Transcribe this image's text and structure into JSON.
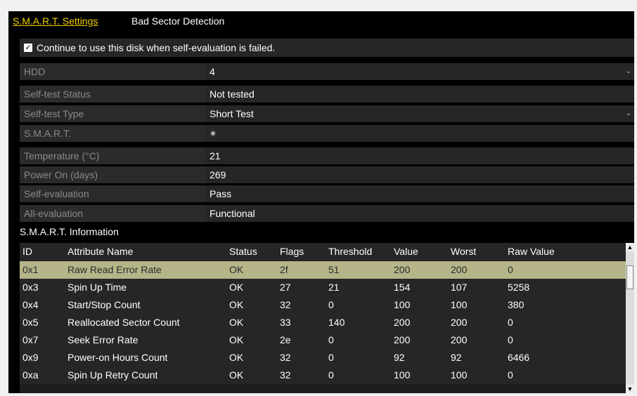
{
  "tabs": [
    {
      "label": "S.M.A.R.T. Settings",
      "active": true
    },
    {
      "label": "Bad Sector Detection",
      "active": false
    }
  ],
  "continue_option": {
    "label": "Continue to use this disk when self-evaluation is failed.",
    "checked": true
  },
  "fields": {
    "hdd": {
      "label": "HDD",
      "value": "4"
    },
    "self_test_status": {
      "label": "Self-test Status",
      "value": "Not tested"
    },
    "self_test_type": {
      "label": "Self-test Type",
      "value": "Short Test"
    },
    "smart": {
      "label": "S.M.A.R.T.",
      "icon": "gear-icon"
    },
    "temperature": {
      "label": "Temperature (°C)",
      "value": "21"
    },
    "power_on": {
      "label": "Power On (days)",
      "value": "269"
    },
    "self_evaluation": {
      "label": "Self-evaluation",
      "value": "Pass"
    },
    "all_evaluation": {
      "label": "All-evaluation",
      "value": "Functional"
    }
  },
  "info_title": "S.M.A.R.T. Information",
  "table": {
    "columns": [
      "ID",
      "Attribute Name",
      "Status",
      "Flags",
      "Threshold",
      "Value",
      "Worst",
      "Raw Value"
    ],
    "rows": [
      [
        "0x1",
        "Raw Read Error Rate",
        "OK",
        "2f",
        "51",
        "200",
        "200",
        "0"
      ],
      [
        "0x3",
        "Spin Up Time",
        "OK",
        "27",
        "21",
        "154",
        "107",
        "5258"
      ],
      [
        "0x4",
        "Start/Stop Count",
        "OK",
        "32",
        "0",
        "100",
        "100",
        "380"
      ],
      [
        "0x5",
        "Reallocated Sector Count",
        "OK",
        "33",
        "140",
        "200",
        "200",
        "0"
      ],
      [
        "0x7",
        "Seek Error Rate",
        "OK",
        "2e",
        "0",
        "200",
        "200",
        "0"
      ],
      [
        "0x9",
        "Power-on Hours Count",
        "OK",
        "32",
        "0",
        "92",
        "92",
        "6466"
      ],
      [
        "0xa",
        "Spin Up Retry Count",
        "OK",
        "32",
        "0",
        "100",
        "100",
        "0"
      ]
    ],
    "selected_row": 0
  },
  "colors": {
    "accent": "#f0d000",
    "selected_row": "#b5b589"
  }
}
